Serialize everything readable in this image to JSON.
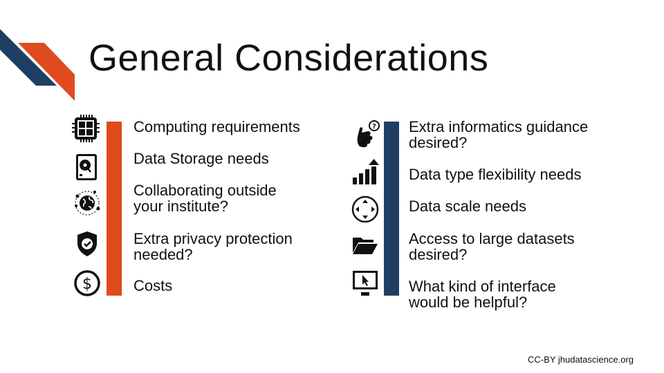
{
  "slide": {
    "title": "General Considerations",
    "credit": "CC-BY jhudatascience.org"
  },
  "colors": {
    "accent_orange": "#e04a1f",
    "accent_navy": "#1f3e64",
    "text": "#111111"
  },
  "left_column": {
    "items": [
      {
        "icon": "cpu-chip-icon",
        "lines": [
          "Computing requirements"
        ]
      },
      {
        "icon": "hard-drive-icon",
        "lines": [
          "Data Storage needs"
        ]
      },
      {
        "icon": "globe-network-icon",
        "lines": [
          "Collaborating outside",
          "your institute?"
        ]
      },
      {
        "icon": "shield-check-icon",
        "lines": [
          "Extra privacy protection",
          "needed?"
        ]
      },
      {
        "icon": "dollar-coin-icon",
        "lines": [
          "Costs"
        ]
      }
    ]
  },
  "right_column": {
    "items": [
      {
        "icon": "hand-question-icon",
        "lines": [
          "Extra informatics guidance",
          "desired?"
        ]
      },
      {
        "icon": "bar-chart-growth-icon",
        "lines": [
          "Data type flexibility needs"
        ]
      },
      {
        "icon": "expand-arrows-icon",
        "lines": [
          "Data scale needs"
        ]
      },
      {
        "icon": "open-folder-icon",
        "lines": [
          "Access to large datasets",
          "desired?"
        ]
      },
      {
        "icon": "monitor-cursor-icon",
        "lines": [
          "What kind of interface",
          "would be helpful?"
        ]
      }
    ]
  }
}
